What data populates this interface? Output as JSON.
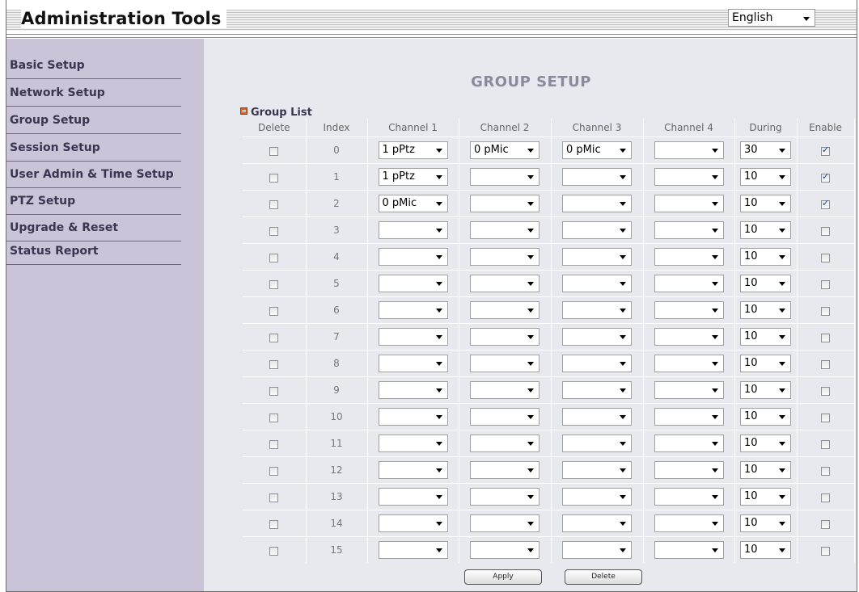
{
  "header": {
    "title": "Administration Tools",
    "language": "English"
  },
  "sidebar": {
    "items": [
      {
        "label": "Basic Setup"
      },
      {
        "label": "Network Setup"
      },
      {
        "label": "Group Setup"
      },
      {
        "label": "Session Setup"
      },
      {
        "label": "User Admin & Time Setup"
      },
      {
        "label": "PTZ Setup"
      },
      {
        "label": "Upgrade & Reset"
      },
      {
        "label": "Status Report"
      }
    ]
  },
  "main": {
    "page_title": "GROUP SETUP",
    "group_list_label": "Group List",
    "columns": [
      "Delete",
      "Index",
      "Channel 1",
      "Channel 2",
      "Channel 3",
      "Channel 4",
      "During",
      "Enable"
    ],
    "rows": [
      {
        "index": "0",
        "ch1": "1 pPtz",
        "ch2": "0 pMic",
        "ch3": "0 pMic",
        "ch4": "",
        "during": "30",
        "enable": true,
        "delete": false
      },
      {
        "index": "1",
        "ch1": "1 pPtz",
        "ch2": "",
        "ch3": "",
        "ch4": "",
        "during": "10",
        "enable": true,
        "delete": false
      },
      {
        "index": "2",
        "ch1": "0 pMic",
        "ch2": "",
        "ch3": "",
        "ch4": "",
        "during": "10",
        "enable": true,
        "delete": false
      },
      {
        "index": "3",
        "ch1": "",
        "ch2": "",
        "ch3": "",
        "ch4": "",
        "during": "10",
        "enable": false,
        "delete": false
      },
      {
        "index": "4",
        "ch1": "",
        "ch2": "",
        "ch3": "",
        "ch4": "",
        "during": "10",
        "enable": false,
        "delete": false
      },
      {
        "index": "5",
        "ch1": "",
        "ch2": "",
        "ch3": "",
        "ch4": "",
        "during": "10",
        "enable": false,
        "delete": false
      },
      {
        "index": "6",
        "ch1": "",
        "ch2": "",
        "ch3": "",
        "ch4": "",
        "during": "10",
        "enable": false,
        "delete": false
      },
      {
        "index": "7",
        "ch1": "",
        "ch2": "",
        "ch3": "",
        "ch4": "",
        "during": "10",
        "enable": false,
        "delete": false
      },
      {
        "index": "8",
        "ch1": "",
        "ch2": "",
        "ch3": "",
        "ch4": "",
        "during": "10",
        "enable": false,
        "delete": false
      },
      {
        "index": "9",
        "ch1": "",
        "ch2": "",
        "ch3": "",
        "ch4": "",
        "during": "10",
        "enable": false,
        "delete": false
      },
      {
        "index": "10",
        "ch1": "",
        "ch2": "",
        "ch3": "",
        "ch4": "",
        "during": "10",
        "enable": false,
        "delete": false
      },
      {
        "index": "11",
        "ch1": "",
        "ch2": "",
        "ch3": "",
        "ch4": "",
        "during": "10",
        "enable": false,
        "delete": false
      },
      {
        "index": "12",
        "ch1": "",
        "ch2": "",
        "ch3": "",
        "ch4": "",
        "during": "10",
        "enable": false,
        "delete": false
      },
      {
        "index": "13",
        "ch1": "",
        "ch2": "",
        "ch3": "",
        "ch4": "",
        "during": "10",
        "enable": false,
        "delete": false
      },
      {
        "index": "14",
        "ch1": "",
        "ch2": "",
        "ch3": "",
        "ch4": "",
        "during": "10",
        "enable": false,
        "delete": false
      },
      {
        "index": "15",
        "ch1": "",
        "ch2": "",
        "ch3": "",
        "ch4": "",
        "during": "10",
        "enable": false,
        "delete": false
      }
    ],
    "buttons": {
      "apply": "Apply",
      "delete": "Delete"
    }
  },
  "colors": {
    "sidebar_bg": "#c9c4d8",
    "main_bg": "#e8e8ef",
    "nav_text": "#3a3550",
    "title_text": "#8b8a9c",
    "icon_accent": "#e05a1a"
  }
}
